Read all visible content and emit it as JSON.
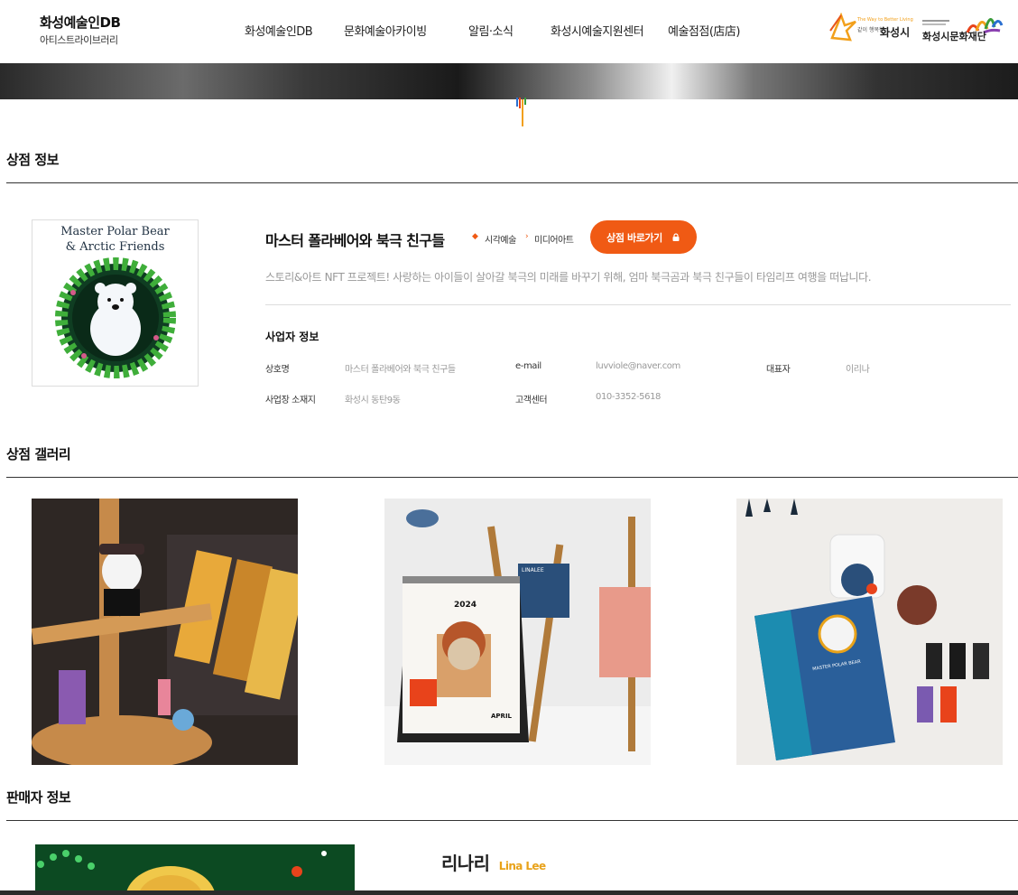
{
  "header": {
    "logo_line1": "화성예술인DB",
    "logo_line2": "아티스트라이브러리",
    "nav": [
      "화성예술인DB",
      "문화예술아카이빙",
      "알림·소식",
      "화성시예술지원센터",
      "예술점점(店店)"
    ],
    "partner1_small": "The Way to Better Living",
    "partner1_sub": "같이 행복한",
    "partner1_name": "화성시",
    "partner2_name": "화성시문화재단"
  },
  "shop": {
    "section_title": "상점 정보",
    "logo_line1": "Master Polar Bear",
    "logo_line2": "& Arctic Friends",
    "name": "마스터 폴라베어와 북극 친구들",
    "category1": "시각예술",
    "category2": "미디어아트",
    "button": "상점 바로가기",
    "description": "스토리&아트 NFT 프로젝트! 사랑하는 아이들이 살아갈 북극의 미래를 바꾸기 위해, 엄마 북극곰과 북극 친구들이 타임리프 여행을 떠납니다.",
    "business_title": "사업자 정보",
    "business": {
      "label_name": "상호명",
      "value_name": "마스터 폴라베어와 북극 친구들",
      "label_email": "e-mail",
      "value_email": "luvviole@naver.com",
      "label_ceo": "대표자",
      "value_ceo": "이리나",
      "label_address": "사업장 소재지",
      "value_address": "화성시 동탄9동",
      "label_phone": "고객센터",
      "value_phone": "010-3352-5618"
    }
  },
  "gallery": {
    "section_title": "상점 갤러리",
    "calendar_year": "2024",
    "calendar_month": "APRIL",
    "postcard_text": "LINALEE",
    "notebook_text": "MASTER POLAR BEAR"
  },
  "seller": {
    "section_title": "판매자 정보",
    "name": "리나리",
    "name_en": "Lina Lee"
  },
  "colors": {
    "accent": "#f05a14",
    "seller_en": "#e8a21a"
  }
}
